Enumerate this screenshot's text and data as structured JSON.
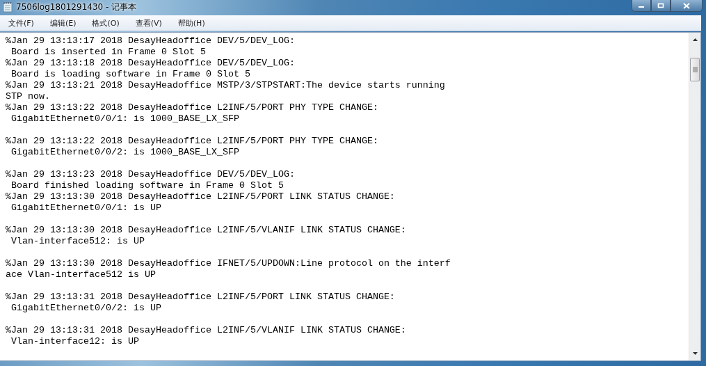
{
  "window": {
    "title": "7506log1801291430 - 记事本"
  },
  "menu": [
    {
      "label": "文件(F)"
    },
    {
      "label": "编辑(E)"
    },
    {
      "label": "格式(O)"
    },
    {
      "label": "查看(V)"
    },
    {
      "label": "帮助(H)"
    }
  ],
  "entries": [
    {
      "lines": [
        "%Jan 29 13:13:17 2018 DesayHeadoffice DEV/5/DEV_LOG:",
        " Board is inserted in Frame 0 Slot 5"
      ],
      "blank_after": false
    },
    {
      "lines": [
        "%Jan 29 13:13:18 2018 DesayHeadoffice DEV/5/DEV_LOG:",
        " Board is loading software in Frame 0 Slot 5"
      ],
      "blank_after": false
    },
    {
      "lines": [
        "%Jan 29 13:13:21 2018 DesayHeadoffice MSTP/3/STPSTART:The device starts running",
        "STP now."
      ],
      "blank_after": false
    },
    {
      "lines": [
        "%Jan 29 13:13:22 2018 DesayHeadoffice L2INF/5/PORT PHY TYPE CHANGE:",
        " GigabitEthernet0/0/1: is 1000_BASE_LX_SFP"
      ],
      "blank_after": true
    },
    {
      "lines": [
        "%Jan 29 13:13:22 2018 DesayHeadoffice L2INF/5/PORT PHY TYPE CHANGE:",
        " GigabitEthernet0/0/2: is 1000_BASE_LX_SFP"
      ],
      "blank_after": true
    },
    {
      "lines": [
        "%Jan 29 13:13:23 2018 DesayHeadoffice DEV/5/DEV_LOG:",
        " Board finished loading software in Frame 0 Slot 5"
      ],
      "blank_after": false
    },
    {
      "lines": [
        "%Jan 29 13:13:30 2018 DesayHeadoffice L2INF/5/PORT LINK STATUS CHANGE:",
        " GigabitEthernet0/0/1: is UP"
      ],
      "blank_after": true
    },
    {
      "lines": [
        "%Jan 29 13:13:30 2018 DesayHeadoffice L2INF/5/VLANIF LINK STATUS CHANGE:",
        " Vlan-interface512: is UP"
      ],
      "blank_after": true
    },
    {
      "lines": [
        "%Jan 29 13:13:30 2018 DesayHeadoffice IFNET/5/UPDOWN:Line protocol on the interf",
        "ace Vlan-interface512 is UP"
      ],
      "blank_after": true
    },
    {
      "lines": [
        "%Jan 29 13:13:31 2018 DesayHeadoffice L2INF/5/PORT LINK STATUS CHANGE:",
        " GigabitEthernet0/0/2: is UP"
      ],
      "blank_after": true
    },
    {
      "lines": [
        "%Jan 29 13:13:31 2018 DesayHeadoffice L2INF/5/VLANIF LINK STATUS CHANGE:",
        " Vlan-interface12: is UP"
      ],
      "blank_after": false
    }
  ]
}
